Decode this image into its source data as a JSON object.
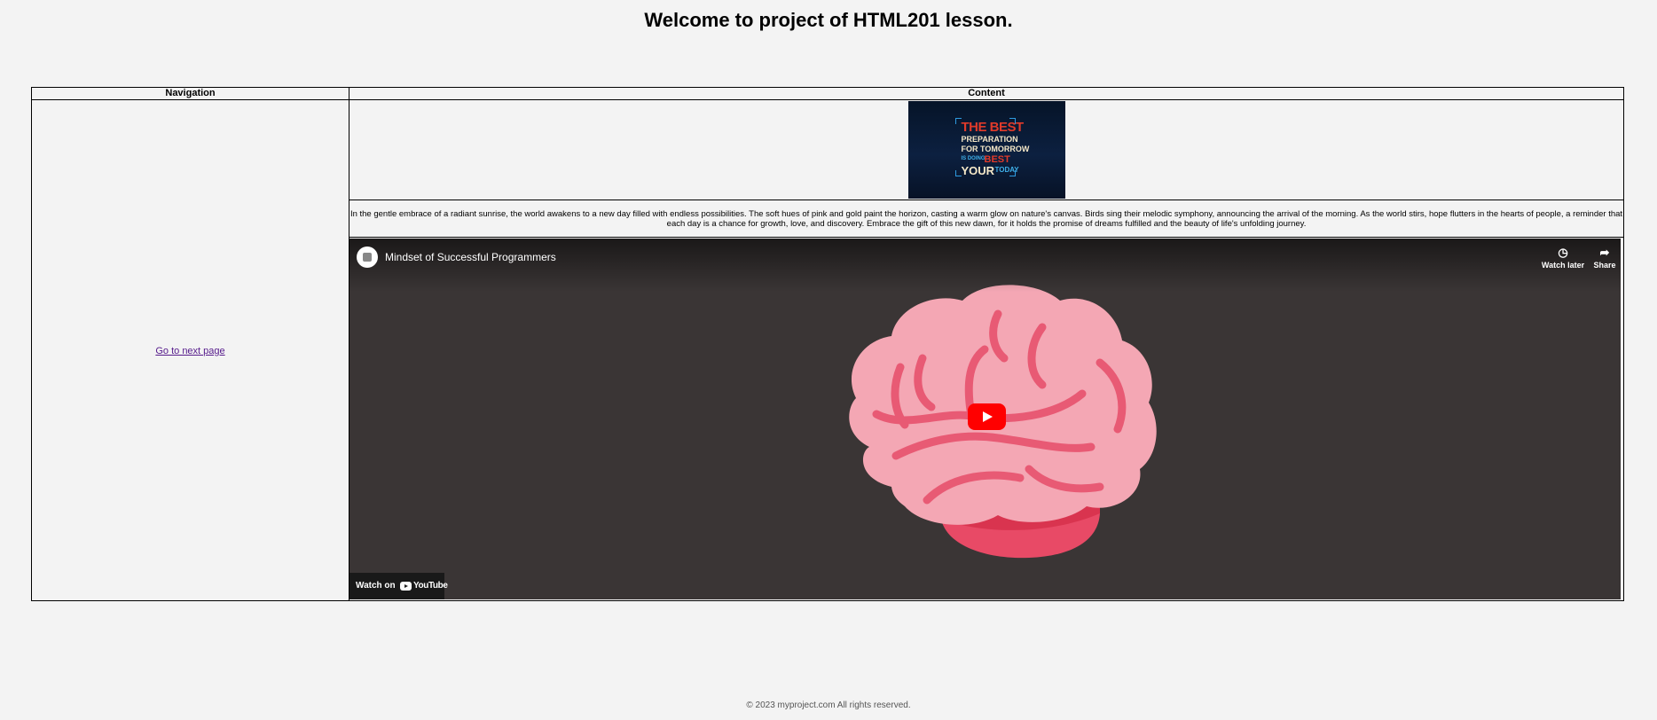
{
  "page": {
    "heading": "Welcome to project of HTML201 lesson.",
    "footer": "© 2023 myproject.com All rights reserved."
  },
  "table": {
    "headers": {
      "navigation": "Navigation",
      "content": "Content"
    },
    "nav_link": "Go to next page"
  },
  "poster": {
    "line1": "THE BEST",
    "line2": "PREPARATION",
    "line3": "FOR TOMORROW",
    "line4a": "IS DOING",
    "line4b": "BEST",
    "line5a": "YOUR",
    "line5b": "TODAY"
  },
  "paragraph": "In the gentle embrace of a radiant sunrise, the world awakens to a new day filled with endless possibilities. The soft hues of pink and gold paint the horizon, casting a warm glow on nature's canvas. Birds sing their melodic symphony, announcing the arrival of the morning. As the world stirs, hope flutters in the hearts of people, a reminder that each day is a chance for growth, love, and discovery. Embrace the gift of this new dawn, for it holds the promise of dreams fulfilled and the beauty of life's unfolding journey.",
  "video": {
    "title": "Mindset of Successful Programmers",
    "watch_later": "Watch later",
    "share": "Share",
    "watch_on": "Watch on",
    "youtube_word": "YouTube",
    "colors": {
      "background": "#3a3535",
      "play": "#ff0000",
      "brain": "#f4a7b4",
      "brain_lines": "#e85a74"
    }
  }
}
